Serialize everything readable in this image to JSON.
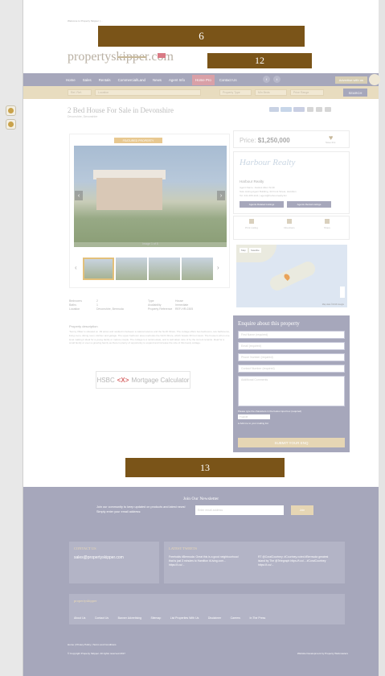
{
  "breadcrumb": "Welcome to Property Skipper | ...",
  "overlays": {
    "top": "6",
    "right": "12",
    "bottom": "13"
  },
  "logo": {
    "text": "propertyskipper.com"
  },
  "nav": {
    "items": [
      "Home",
      "Sales",
      "Rentals",
      "Commercial/Land",
      "News",
      "Agent Info",
      "Home Pro",
      "Contact Us"
    ],
    "social": [
      "f",
      "t"
    ],
    "advertise": "Advertise with us"
  },
  "search": {
    "refno_placeholder": "Ref. Ref.",
    "location_placeholder": "Location",
    "type_placeholder": "Property Type",
    "beds_placeholder": "Min Beds",
    "price_placeholder": "Price Range",
    "button": "SEARCH"
  },
  "listing": {
    "title": "2 Bed House For Sale in Devonshire",
    "subtitle": "Devonshire, Devonshire",
    "featured": "FEATURED PROPERTY",
    "image_count": "Image 1 of 5",
    "details": [
      {
        "k": "Bedrooms",
        "v": "2",
        "k2": "Type",
        "v2": "House"
      },
      {
        "k": "Baths",
        "v": "1",
        "k2": "Availability",
        "v2": "Immediate"
      },
      {
        "k": "Location",
        "v": "Devonshire, Bermuda",
        "k2": "Property Reference",
        "v2": "REF-HR-0305"
      }
    ],
    "description_heading": "Property description",
    "description": "'Sunny Villas' is situated on .99 acres and nestled in between a natural reserve and the North Shore. The cottage offers two bedrooms, two bathrooms, living room, dining room, kitchen and garage. The upper bedroom area overlooks the North Shore, which boasts 30 foot views. The house is all on one level making it ideal for a young family or mature couple. The cottage is a rental estate, and is well taken care of by the current tenants. Ideal for a small family or even a growing family as there is plenty of opportunity to expand and increase the size of this lovely cottage."
  },
  "mortgage": {
    "brand": "HSBC",
    "symbol": "<X>",
    "label": "Mortgage Calculator"
  },
  "price": {
    "label": "Price:",
    "value": "$1,250,000",
    "save": "Save this"
  },
  "agent": {
    "logo_text": "Harbour Realty",
    "name": "Harbour Realty",
    "lines": [
      "Agent Name: Jessica Allen Smith",
      "Sole Listing Agent Building, 34 Front Street, Hamilton",
      "Tel: 441-295-1111 | agent@harbourrealty.bm"
    ],
    "buttons": [
      "Agents Related Listings",
      "Agents Rental Listings"
    ],
    "icons": [
      "Print Listing",
      "Directions",
      "Share"
    ]
  },
  "map": {
    "tab_map": "Map",
    "tab_sat": "Satellite",
    "attribution": "Map data ©2016 Google"
  },
  "enquiry": {
    "title": "Enquire about this property",
    "fields": [
      "First Name (required)",
      "Email (required)",
      "Phone Number (required)",
      "Contact Number (required)"
    ],
    "message_placeholder": "Additional Comments",
    "captcha_note": "Please type the characters in the below input box (required)",
    "captcha_value": "Tmdm5",
    "checkbox": "Add me to your mailing list",
    "submit": "SUBMIT YOUR ENQ"
  },
  "newsletter": {
    "title": "Join Our Newsletter",
    "text": "Join our community to keep updated on products and latest news! Simply enter your email address:",
    "placeholder": "Enter email address",
    "button": "Join"
  },
  "contact": {
    "title": "CONTACT US",
    "email": "sales@propertyskipper.com"
  },
  "tweets": {
    "title": "LATEST TWEETS",
    "items": [
      "Freeholds #Bermuda: Great this is a good neighbourhood that is just 3 minutes to Hamilton #Living.com... https://t.co/...",
      "RT @CoralCourtney: #Courtney-voted #Bermuda greatest island by The @Telegraph https://t.co/... #CoralCourtney https://t.co/..."
    ]
  },
  "footer_links": {
    "title": "propertyskipper",
    "items": [
      "About Us",
      "Contact Us",
      "Banner Advertising",
      "Sitemap",
      "List Properties With Us",
      "Disclaimer",
      "Careers",
      "In The Press"
    ]
  },
  "legal": {
    "links": "Home  |  Privacy Policy  |  Terms and Conditions",
    "copyright": "© Copyright Property Skipper. All rights reserved 2017",
    "developer": "Website Development by Property Webmasters"
  }
}
